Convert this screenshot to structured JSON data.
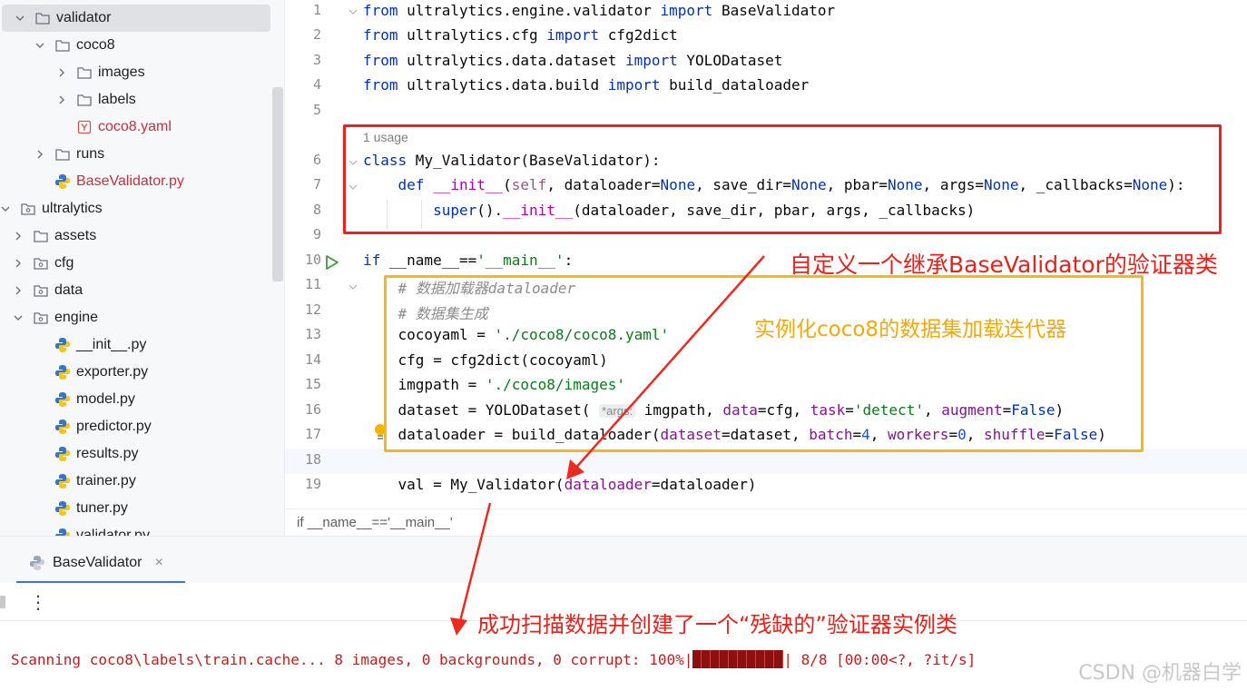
{
  "project_tree": {
    "items": [
      {
        "label": "validator",
        "kind": "folder",
        "chevron": "down",
        "selected": true
      },
      {
        "label": "coco8",
        "kind": "folder",
        "chevron": "down"
      },
      {
        "label": "images",
        "kind": "folder",
        "chevron": "right"
      },
      {
        "label": "labels",
        "kind": "folder",
        "chevron": "right"
      },
      {
        "label": "coco8.yaml",
        "kind": "yaml",
        "chevron": "none",
        "modified": true
      },
      {
        "label": "runs",
        "kind": "folder",
        "chevron": "right"
      },
      {
        "label": "BaseValidator.py",
        "kind": "python",
        "chevron": "none",
        "modified": true
      },
      {
        "label": "ultralytics",
        "kind": "package",
        "chevron": "down"
      },
      {
        "label": "assets",
        "kind": "folder",
        "chevron": "right"
      },
      {
        "label": "cfg",
        "kind": "package",
        "chevron": "right"
      },
      {
        "label": "data",
        "kind": "package",
        "chevron": "right"
      },
      {
        "label": "engine",
        "kind": "package",
        "chevron": "down"
      },
      {
        "label": "__init__.py",
        "kind": "python",
        "chevron": "none"
      },
      {
        "label": "exporter.py",
        "kind": "python",
        "chevron": "none"
      },
      {
        "label": "model.py",
        "kind": "python",
        "chevron": "none"
      },
      {
        "label": "predictor.py",
        "kind": "python",
        "chevron": "none"
      },
      {
        "label": "results.py",
        "kind": "python",
        "chevron": "none"
      },
      {
        "label": "trainer.py",
        "kind": "python",
        "chevron": "none"
      },
      {
        "label": "tuner.py",
        "kind": "python",
        "chevron": "none"
      },
      {
        "label": "validator.py",
        "kind": "python",
        "chevron": "none"
      }
    ]
  },
  "editor": {
    "usage_hint": "1 usage",
    "line_numbers": [
      "1",
      "2",
      "3",
      "4",
      "5",
      "6",
      "7",
      "8",
      "9",
      "10",
      "11",
      "12",
      "13",
      "14",
      "15",
      "16",
      "17",
      "18",
      "19"
    ],
    "lines": [
      [
        {
          "t": "from",
          "c": "kw"
        },
        {
          "t": " ultralytics.engine.validator "
        },
        {
          "t": "import",
          "c": "kw"
        },
        {
          "t": " BaseValidator"
        }
      ],
      [
        {
          "t": "from",
          "c": "kw"
        },
        {
          "t": " ultralytics.cfg "
        },
        {
          "t": "import",
          "c": "kw"
        },
        {
          "t": " cfg2dict"
        }
      ],
      [
        {
          "t": "from",
          "c": "kw"
        },
        {
          "t": " ultralytics.data.dataset "
        },
        {
          "t": "import",
          "c": "kw"
        },
        {
          "t": " YOLODataset"
        }
      ],
      [
        {
          "t": "from",
          "c": "kw"
        },
        {
          "t": " ultralytics.data.build "
        },
        {
          "t": "import",
          "c": "kw"
        },
        {
          "t": " build_dataloader"
        }
      ],
      [],
      [
        {
          "t": "class",
          "c": "kw"
        },
        {
          "t": " My_Validator(BaseValidator):"
        }
      ],
      [
        {
          "t": "    "
        },
        {
          "t": "def",
          "c": "kw"
        },
        {
          "t": " "
        },
        {
          "t": "__init__",
          "c": "dund"
        },
        {
          "t": "("
        },
        {
          "t": "self",
          "c": "slf"
        },
        {
          "t": ", dataloader="
        },
        {
          "t": "None",
          "c": "kw"
        },
        {
          "t": ", save_dir="
        },
        {
          "t": "None",
          "c": "kw"
        },
        {
          "t": ", pbar="
        },
        {
          "t": "None",
          "c": "kw"
        },
        {
          "t": ", args="
        },
        {
          "t": "None",
          "c": "kw"
        },
        {
          "t": ", _callbacks="
        },
        {
          "t": "None",
          "c": "kw"
        },
        {
          "t": "):"
        }
      ],
      [
        {
          "t": "        "
        },
        {
          "t": "super",
          "c": "kw"
        },
        {
          "t": "()."
        },
        {
          "t": "__init__",
          "c": "dund"
        },
        {
          "t": "(dataloader, save_dir, pbar, args, _callbacks)"
        }
      ],
      [],
      [
        {
          "t": "if",
          "c": "kw"
        },
        {
          "t": " __name__=="
        },
        {
          "t": "'__main__'",
          "c": "str"
        },
        {
          "t": ":"
        }
      ],
      [
        {
          "t": "    "
        },
        {
          "t": "# 数据加载器dataloader",
          "c": "cmt"
        }
      ],
      [
        {
          "t": "    "
        },
        {
          "t": "# 数据集生成",
          "c": "cmt"
        }
      ],
      [
        {
          "t": "    cocoyaml = "
        },
        {
          "t": "'./coco8/coco8.yaml'",
          "c": "str"
        }
      ],
      [
        {
          "t": "    cfg = cfg2dict(cocoyaml)"
        }
      ],
      [
        {
          "t": "    imgpath = "
        },
        {
          "t": "'./coco8/images'",
          "c": "str"
        }
      ],
      [
        {
          "t": "    dataset = YOLODataset( "
        },
        {
          "t": "*args:",
          "c": "hint"
        },
        {
          "t": " imgpath, "
        },
        {
          "t": "data",
          "c": "param"
        },
        {
          "t": "=cfg, "
        },
        {
          "t": "task",
          "c": "param"
        },
        {
          "t": "="
        },
        {
          "t": "'detect'",
          "c": "str"
        },
        {
          "t": ", "
        },
        {
          "t": "augment",
          "c": "param"
        },
        {
          "t": "="
        },
        {
          "t": "False",
          "c": "kw"
        },
        {
          "t": ")"
        }
      ],
      [
        {
          "t": "    dataloader = build_dataloader("
        },
        {
          "t": "dataset",
          "c": "param"
        },
        {
          "t": "=dataset, "
        },
        {
          "t": "batch",
          "c": "param"
        },
        {
          "t": "="
        },
        {
          "t": "4",
          "c": "num"
        },
        {
          "t": ", "
        },
        {
          "t": "workers",
          "c": "param"
        },
        {
          "t": "="
        },
        {
          "t": "0",
          "c": "num"
        },
        {
          "t": ", "
        },
        {
          "t": "shuffle",
          "c": "param"
        },
        {
          "t": "="
        },
        {
          "t": "False",
          "c": "kw"
        },
        {
          "t": ")"
        }
      ],
      [],
      [
        {
          "t": "    val = My_Validator("
        },
        {
          "t": "dataloader",
          "c": "param"
        },
        {
          "t": "=dataloader)"
        }
      ]
    ]
  },
  "breadcrumb": "if __name__=='__main__'",
  "run_window": {
    "tab_label": "BaseValidator",
    "tab_close": "×",
    "more_icon": "⋮",
    "console_prefix": "Scanning coco8\\labels\\train.cache... 8 images, 0 backgrounds, 0 corrupt: 100%|",
    "console_suffix": "| 8/8 [00:00<?, ?it/s]",
    "progress": 1.0
  },
  "annotations": {
    "red_box_note": "自定义一个继承BaseValidator的验证器类",
    "yellow_box_note": "实例化coco8的数据集加载迭代器",
    "console_note": "成功扫描数据并创建了一个“残缺的”验证器实例类",
    "red_color": "#e8221a",
    "yellow_color": "#f4a90a"
  },
  "watermark": "CSDN @机器白学"
}
